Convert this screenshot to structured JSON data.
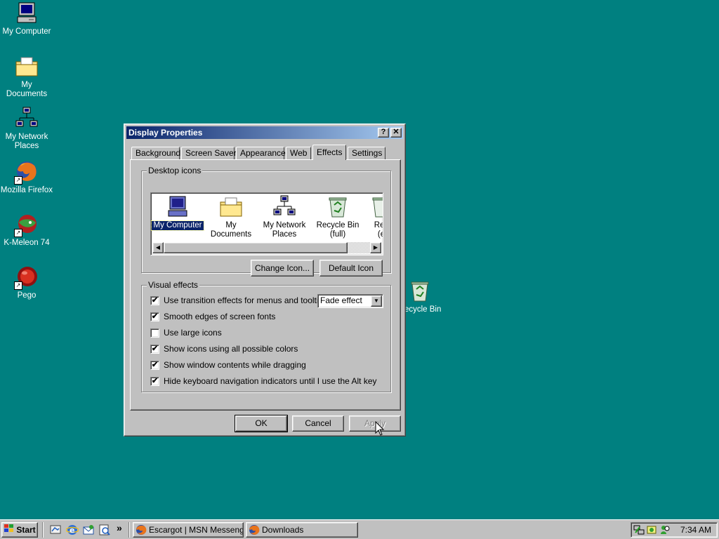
{
  "desktop": {
    "icons": [
      {
        "label": "My Computer"
      },
      {
        "label": "My Documents"
      },
      {
        "label": "My Network\nPlaces"
      },
      {
        "label": "Mozilla Firefox"
      },
      {
        "label": "K-Meleon 74"
      },
      {
        "label": "Pego"
      }
    ],
    "recycle_bin_label": "Recycle Bin"
  },
  "dialog": {
    "title": "Display Properties",
    "help_glyph": "?",
    "close_glyph": "✕",
    "tabs": [
      {
        "label": "Background"
      },
      {
        "label": "Screen Saver"
      },
      {
        "label": "Appearance"
      },
      {
        "label": "Web"
      },
      {
        "label": "Effects"
      },
      {
        "label": "Settings"
      }
    ],
    "desktop_icons_group": {
      "title": "Desktop icons",
      "items": [
        {
          "label": "My Computer",
          "selected": true
        },
        {
          "label": "My Documents"
        },
        {
          "label": "My Network\nPlaces"
        },
        {
          "label": "Recycle Bin\n(full)"
        },
        {
          "label": "Rec\n(e"
        }
      ],
      "change_icon_button": "Change Icon...",
      "default_icon_button": "Default Icon"
    },
    "visual_effects_group": {
      "title": "Visual effects",
      "options": [
        {
          "label": "Use transition effects for menus and tooltips",
          "checked": true
        },
        {
          "label": "Smooth edges of screen fonts",
          "checked": true
        },
        {
          "label": "Use large icons",
          "checked": false
        },
        {
          "label": "Show icons using all possible colors",
          "checked": true
        },
        {
          "label": "Show window contents while dragging",
          "checked": true
        },
        {
          "label": "Hide keyboard navigation indicators until I use the Alt key",
          "checked": true
        }
      ],
      "transition_select_value": "Fade effect"
    },
    "buttons": {
      "ok": "OK",
      "cancel": "Cancel",
      "apply": "Apply"
    }
  },
  "taskbar": {
    "start_label": "Start",
    "tasks": [
      {
        "label": "Escargot | MSN Messenge..."
      },
      {
        "label": "Downloads"
      }
    ],
    "overflow_glyph": "»",
    "clock": "7:34 AM"
  },
  "colors": {
    "desktop": "#008080",
    "title_active": "#0a246a",
    "face": "#c0c0c0"
  }
}
